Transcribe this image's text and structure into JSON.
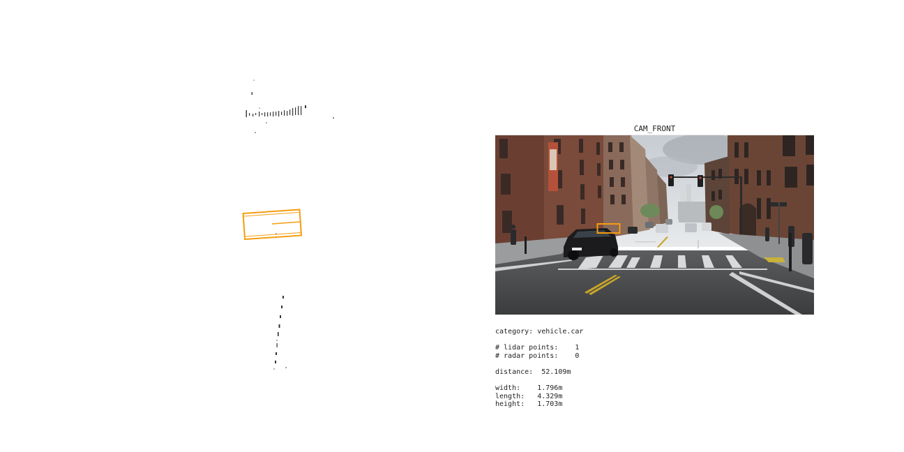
{
  "camera": {
    "title": "CAM_FRONT",
    "highlight_color": "#f59d0f"
  },
  "lidar_view": {
    "box_color": "#f59d0f",
    "point_color": "#333333"
  },
  "info": {
    "category_label": "category:",
    "category_value": "vehicle.car",
    "lidar_label": "# lidar points:",
    "lidar_value": "1",
    "radar_label": "# radar points:",
    "radar_value": "0",
    "distance_label": "distance:",
    "distance_value": "52.109m",
    "width_label": "width:",
    "width_value": "1.796m",
    "length_label": "length:",
    "length_value": "4.329m",
    "height_label": "height:",
    "height_value": "1.703m"
  }
}
